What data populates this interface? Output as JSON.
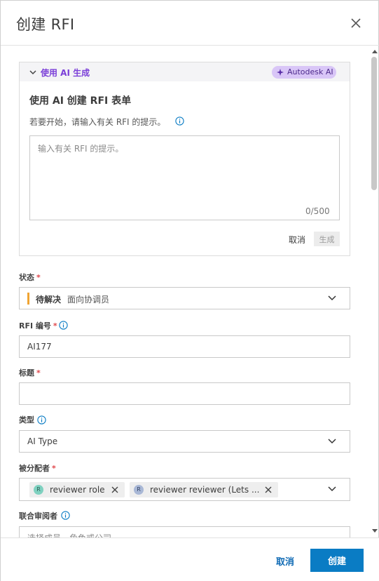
{
  "dialog": {
    "title": "创建 RFI"
  },
  "ai_panel": {
    "header_label": "使用 AI 生成",
    "badge_label": "Autodesk AI",
    "title": "使用 AI 创建 RFI 表单",
    "hint": "若要开始，请输入有关 RFI 的提示。",
    "prompt_placeholder": "输入有关 RFI 的提示。",
    "prompt_value": "",
    "counter": "0/500",
    "cancel_label": "取消",
    "generate_label": "生成"
  },
  "form": {
    "status": {
      "label": "状态",
      "required_mark": "*",
      "value_main": "待解决",
      "value_sub": "面向协调员",
      "accent_color": "#f0a432"
    },
    "rfi_number": {
      "label": "RFI 编号",
      "required_mark": "*",
      "value": "AI177"
    },
    "title_field": {
      "label": "标题",
      "required_mark": "*",
      "value": ""
    },
    "type": {
      "label": "类型",
      "value": "AI Type"
    },
    "assignees": {
      "label": "被分配者",
      "required_mark": "*",
      "chips": [
        {
          "avatar": "R",
          "label": "reviewer role",
          "avatar_color": "#7fd1c0"
        },
        {
          "avatar": "R",
          "label": "reviewer reviewer (Lets ...",
          "avatar_color": "#a9b8d6"
        }
      ]
    },
    "co_reviewers": {
      "label": "联合审阅者",
      "placeholder": "选择成员、角色或公司"
    }
  },
  "footer": {
    "cancel_label": "取消",
    "create_label": "创建"
  },
  "colors": {
    "primary": "#0a7cc4",
    "ai_accent": "#7b3fd8",
    "required": "#e0474c"
  }
}
